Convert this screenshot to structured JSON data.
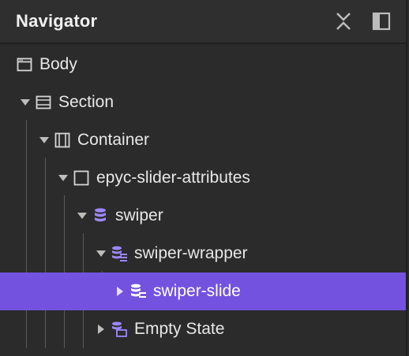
{
  "panel": {
    "title": "Navigator",
    "icons": [
      "close-x-icon",
      "dock-panel-icon"
    ]
  },
  "tree": {
    "nodes": [
      {
        "label": "Body",
        "icon": "window-icon",
        "expanded": true,
        "has_caret": false,
        "selected": false
      },
      {
        "label": "Section",
        "icon": "section-icon",
        "expanded": true,
        "has_caret": true,
        "selected": false
      },
      {
        "label": "Container",
        "icon": "container-icon",
        "expanded": true,
        "has_caret": true,
        "selected": false
      },
      {
        "label": "epyc-slider-attributes",
        "icon": "div-block-icon",
        "expanded": true,
        "has_caret": true,
        "selected": false
      },
      {
        "label": "swiper",
        "icon": "collection-list-wrapper-icon",
        "expanded": true,
        "has_caret": true,
        "selected": false
      },
      {
        "label": "swiper-wrapper",
        "icon": "collection-list-icon",
        "expanded": true,
        "has_caret": true,
        "selected": false
      },
      {
        "label": "swiper-slide",
        "icon": "collection-item-icon",
        "expanded": false,
        "has_caret": true,
        "selected": true
      },
      {
        "label": "Empty State",
        "icon": "empty-state-icon",
        "expanded": false,
        "has_caret": true,
        "selected": false
      }
    ]
  },
  "colors": {
    "selected_row": "#7452e0",
    "collection_icon": "#9d87ff",
    "panel_bg": "#2b2b2b"
  }
}
